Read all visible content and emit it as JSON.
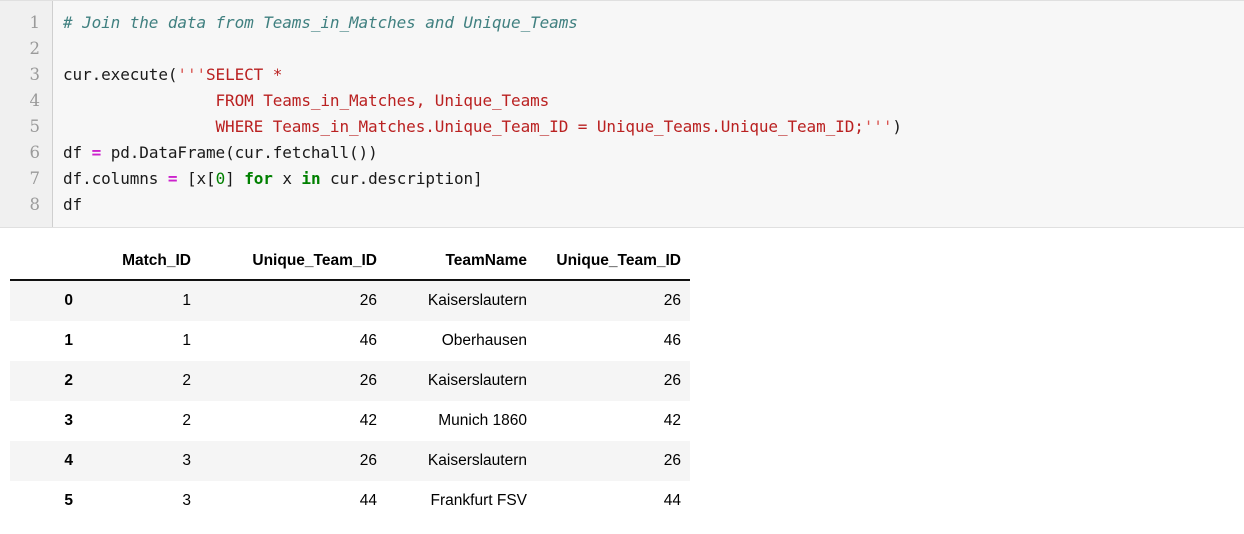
{
  "code_cell": {
    "line_numbers": [
      "1",
      "2",
      "3",
      "4",
      "5",
      "6",
      "7",
      "8"
    ],
    "lines": [
      {
        "n": 1,
        "tokens": [
          {
            "t": "comment",
            "s": "# Join the data from Teams_in_Matches and Unique_Teams"
          }
        ]
      },
      {
        "n": 2,
        "tokens": [
          {
            "t": "plain",
            "s": ""
          }
        ]
      },
      {
        "n": 3,
        "tokens": [
          {
            "t": "plain",
            "s": "cur.execute("
          },
          {
            "t": "quote",
            "s": "'''"
          },
          {
            "t": "string",
            "s": "SELECT *"
          }
        ]
      },
      {
        "n": 4,
        "tokens": [
          {
            "t": "string",
            "s": "                FROM Teams_in_Matches, Unique_Teams"
          }
        ]
      },
      {
        "n": 5,
        "tokens": [
          {
            "t": "string",
            "s": "                WHERE Teams_in_Matches.Unique_Team_ID = Unique_Teams.Unique_Team_ID;"
          },
          {
            "t": "quote",
            "s": "'''"
          },
          {
            "t": "plain",
            "s": ")"
          }
        ]
      },
      {
        "n": 6,
        "tokens": [
          {
            "t": "plain",
            "s": "df "
          },
          {
            "t": "op",
            "s": "="
          },
          {
            "t": "plain",
            "s": " pd.DataFrame(cur.fetchall())"
          }
        ]
      },
      {
        "n": 7,
        "tokens": [
          {
            "t": "plain",
            "s": "df.columns "
          },
          {
            "t": "op",
            "s": "="
          },
          {
            "t": "plain",
            "s": " [x["
          },
          {
            "t": "num",
            "s": "0"
          },
          {
            "t": "plain",
            "s": "] "
          },
          {
            "t": "kw",
            "s": "for"
          },
          {
            "t": "plain",
            "s": " x "
          },
          {
            "t": "kw",
            "s": "in"
          },
          {
            "t": "plain",
            "s": " cur.description]"
          }
        ]
      },
      {
        "n": 8,
        "tokens": [
          {
            "t": "plain",
            "s": "df"
          }
        ]
      }
    ],
    "raw_text": "# Join the data from Teams_in_Matches and Unique_Teams\n\ncur.execute('''SELECT *\n                FROM Teams_in_Matches, Unique_Teams\n                WHERE Teams_in_Matches.Unique_Team_ID = Unique_Teams.Unique_Team_ID;''')\ndf = pd.DataFrame(cur.fetchall())\ndf.columns = [x[0] for x in cur.description]\ndf"
  },
  "output_table": {
    "index_header": "",
    "columns": [
      "Match_ID",
      "Unique_Team_ID",
      "TeamName",
      "Unique_Team_ID"
    ],
    "rows": [
      {
        "index": "0",
        "cells": [
          "1",
          "26",
          "Kaiserslautern",
          "26"
        ]
      },
      {
        "index": "1",
        "cells": [
          "1",
          "46",
          "Oberhausen",
          "46"
        ]
      },
      {
        "index": "2",
        "cells": [
          "2",
          "26",
          "Kaiserslautern",
          "26"
        ]
      },
      {
        "index": "3",
        "cells": [
          "2",
          "42",
          "Munich 1860",
          "42"
        ]
      },
      {
        "index": "4",
        "cells": [
          "3",
          "26",
          "Kaiserslautern",
          "26"
        ]
      },
      {
        "index": "5",
        "cells": [
          "3",
          "44",
          "Frankfurt FSV",
          "44"
        ]
      }
    ]
  },
  "colors": {
    "cell_background": "#f7f7f7",
    "gutter_background": "#f0f0f0",
    "comment": "#408080",
    "string": "#ba2121",
    "operator": "#cc22cc",
    "keyword": "#008000",
    "number": "#008000",
    "table_stripe": "#f5f5f5",
    "table_rule": "#111111"
  }
}
